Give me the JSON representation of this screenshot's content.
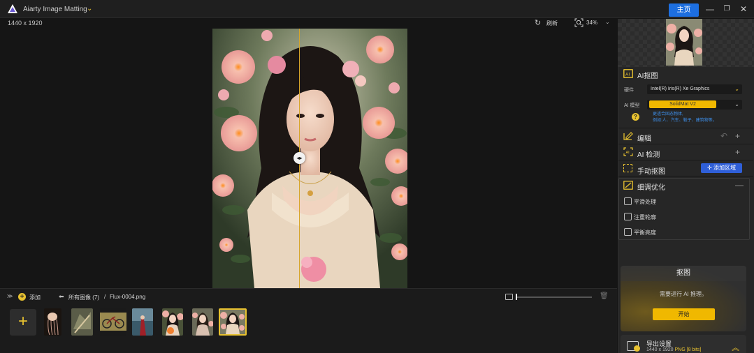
{
  "titlebar": {
    "app_title": "Aiarty Image Matting",
    "home_label": "主页",
    "minimize": "—",
    "restore": "❐",
    "close": "✕"
  },
  "canvas": {
    "dimensions": "1440 x 1920",
    "refresh_label": "刷新",
    "zoom_label": "34%",
    "compare_handle": "◂▸"
  },
  "panel": {
    "ai_matting": {
      "title": "AI抠图",
      "hardware_label": "硬件",
      "hardware_value": "Intel(R) Iris(R) Xe Graphics",
      "model_label": "AI 模型",
      "model_value": "SolidMat  V2",
      "help": "?",
      "desc_line1": "更适合固态物体,",
      "desc_line2": "例如:人、汽车、鞋子、建筑物等。"
    },
    "edit": {
      "title": "编辑"
    },
    "ai_detect": {
      "title": "AI 检测"
    },
    "manual": {
      "title": "手动抠图",
      "add_area": "添加区域"
    },
    "refine": {
      "title": "细调优化",
      "options": [
        "平滑处理",
        "注重轮廓",
        "平衡亮度"
      ]
    },
    "matting": {
      "title": "抠图",
      "message": "需要进行 AI 推理。",
      "start": "开始"
    },
    "export": {
      "title": "导出设置",
      "size": "1440 x 1920",
      "format": "PNG",
      "bits": "[8 bits]"
    }
  },
  "filmstrip": {
    "add_label": "添加",
    "all_images": "所有图像 (7)",
    "separator": "/",
    "current_file": "Flux-0004.png",
    "add_tile": "+"
  },
  "colors": {
    "accent": "#e8c230",
    "primary_blue": "#1d6fe0",
    "panel_bg": "#262626"
  }
}
